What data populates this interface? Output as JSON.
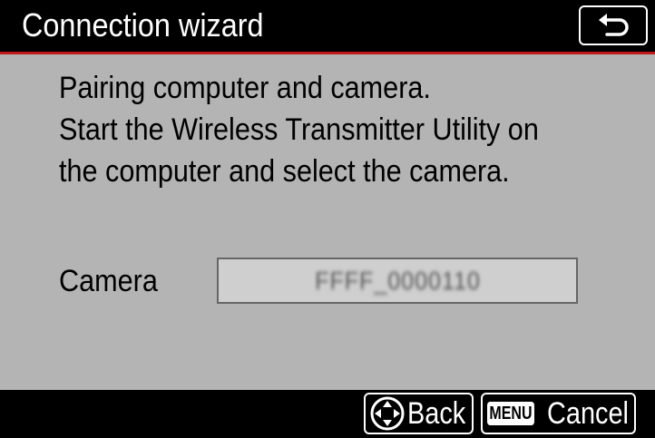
{
  "header": {
    "title": "Connection wizard",
    "return_icon": "return-arrow-icon"
  },
  "message": {
    "lines": [
      "Pairing computer and camera.",
      "Start the Wireless Transmitter Utility on",
      "the computer and select the camera."
    ]
  },
  "camera": {
    "label": "Camera",
    "value": "FFFF_0000110"
  },
  "footer": {
    "back": {
      "icon": "multi-selector-icon",
      "label": "Back"
    },
    "cancel": {
      "badge": "MENU",
      "label": "Cancel"
    }
  },
  "colors": {
    "background": "#b4b4b4",
    "bar": "#000000",
    "accent_rule": "#c01818"
  }
}
